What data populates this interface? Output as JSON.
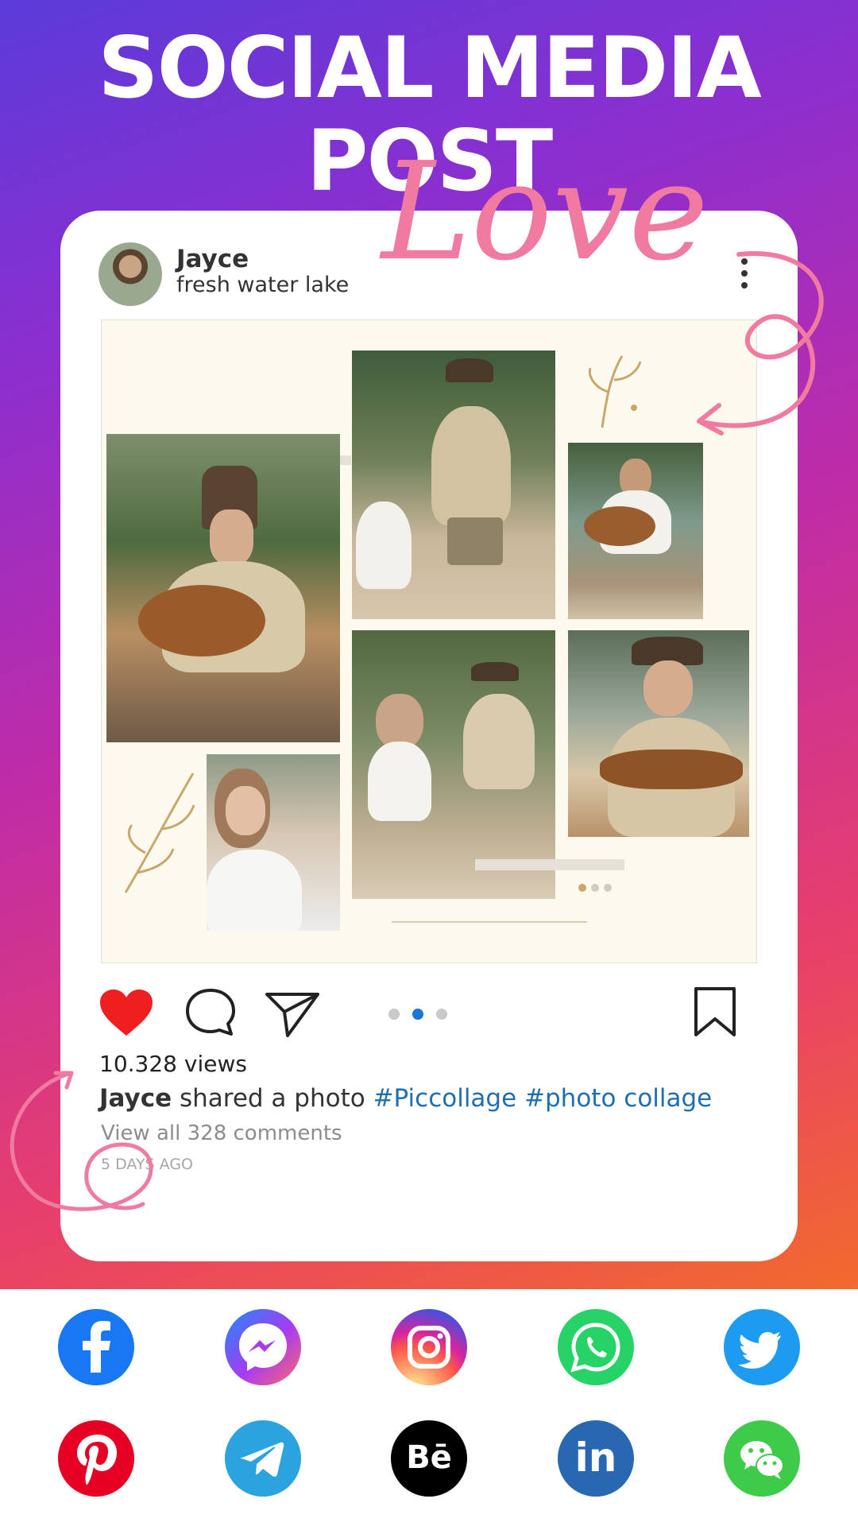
{
  "headline": "SOCIAL MEDIA POST",
  "decoration": {
    "script_text": "Love",
    "color": "#f07aa0"
  },
  "post": {
    "username": "Jayce",
    "location": "fresh water lake",
    "views": "10.328 views",
    "caption_user": "Jayce",
    "caption_text": " shared a photo ",
    "hashtags": "#Piccollage #photo collage",
    "view_comments": "View all 328 comments",
    "time_ago": "5 DAYS AGO",
    "liked": true,
    "carousel_pages": 3,
    "carousel_active_page": 2
  },
  "collage": {
    "photos": [
      "man-guitar-closeup",
      "woman-portrait",
      "man-standing-guitar",
      "couple-sitting",
      "woman-guitar",
      "man-smiling-guitar"
    ],
    "pager_pages": 3,
    "pager_active_page": 1
  },
  "share_targets": [
    {
      "name": "facebook-icon",
      "color": "#1877f2"
    },
    {
      "name": "messenger-icon",
      "color": "#a83af1"
    },
    {
      "name": "instagram-icon",
      "color": "#e1306c"
    },
    {
      "name": "whatsapp-icon",
      "color": "#25d366"
    },
    {
      "name": "twitter-icon",
      "color": "#1d9bf0"
    },
    {
      "name": "pinterest-icon",
      "color": "#e60023"
    },
    {
      "name": "telegram-icon",
      "color": "#2aa3de"
    },
    {
      "name": "behance-icon",
      "color": "#000000",
      "text": "Bē"
    },
    {
      "name": "linkedin-icon",
      "color": "#2867b2",
      "text": "in"
    },
    {
      "name": "wechat-icon",
      "color": "#3ecb4a"
    }
  ]
}
